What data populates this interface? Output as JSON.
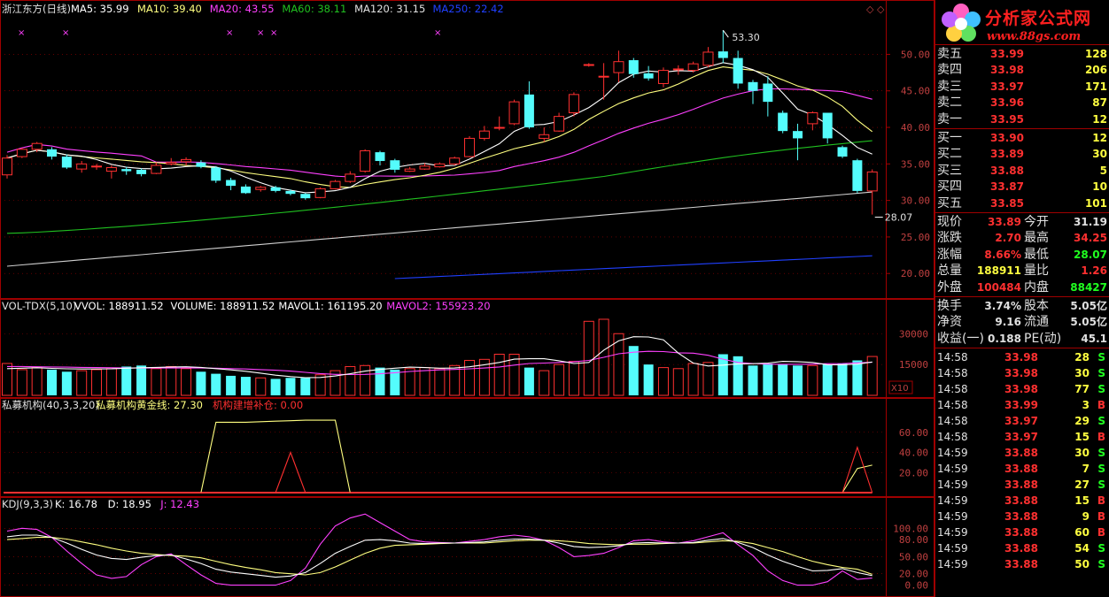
{
  "colors": {
    "up": "#ff3030",
    "down": "#54fcfc",
    "ma5": "#ffffff",
    "ma10": "#ffff80",
    "ma20": "#ff40ff",
    "ma60": "#20c020",
    "ma120": "#d0d0d0",
    "ma250": "#2040ff",
    "grid": "#a00000",
    "axis_text": "#c04040"
  },
  "main_panel": {
    "stock_name": "浙江东方(日线)",
    "ma_legend": [
      {
        "label": "MA5: 35.99",
        "color": "#ffffff"
      },
      {
        "label": "MA10: 39.40",
        "color": "#ffff80"
      },
      {
        "label": "MA20: 43.55",
        "color": "#ff40ff"
      },
      {
        "label": "MA60: 38.11",
        "color": "#20c020"
      },
      {
        "label": "MA120: 31.15",
        "color": "#e0e0e0"
      },
      {
        "label": "MA250: 22.42",
        "color": "#2040ff"
      }
    ],
    "y_ticks": [
      "50.00",
      "45.00",
      "40.00",
      "35.00",
      "30.00",
      "25.00",
      "20.00"
    ],
    "high_annotation": "53.30",
    "low_annotation": "28.07",
    "window_controls": "◇ ◇"
  },
  "vol_panel": {
    "title": "VOL-TDX(5,10)",
    "legend": [
      {
        "label": "VVOL: 188911.52",
        "color": "#ffffff"
      },
      {
        "label": "VOLUME: 188911.52",
        "color": "#ffffff"
      },
      {
        "label": "MAVOL1: 161195.20",
        "color": "#ffffff"
      },
      {
        "label": "MAVOL2: 155923.20",
        "color": "#ff40ff"
      }
    ],
    "y_ticks": [
      "30000",
      "15000"
    ],
    "unit": "X10"
  },
  "fund_panel": {
    "title": "私募机构(40,3,3,20)",
    "legend": [
      {
        "label": "私募机构黄金线: 27.30",
        "color": "#ffff80"
      },
      {
        "label": "机构建增补仓: 0.00",
        "color": "#ff3030"
      }
    ],
    "y_ticks": [
      "60.00",
      "40.00",
      "20.00"
    ]
  },
  "kdj_panel": {
    "title": "KDJ(9,3,3)",
    "legend": [
      {
        "label": "K: 16.78",
        "color": "#ffffff"
      },
      {
        "label": "D: 18.95",
        "color": "#ffffff"
      },
      {
        "label": "J: 12.43",
        "color": "#ff40ff"
      }
    ],
    "y_ticks": [
      "100.00",
      "80.00",
      "50.00",
      "20.00",
      "0.00"
    ]
  },
  "chart_data": {
    "type": "candlestick",
    "candles": [
      [
        33.5,
        35.8,
        33.0,
        36.2
      ],
      [
        36.0,
        37.0,
        35.8,
        37.2
      ],
      [
        37.0,
        37.8,
        36.6,
        38.0
      ],
      [
        37.0,
        36.0,
        35.6,
        37.3
      ],
      [
        36.0,
        34.5,
        34.3,
        36.3
      ],
      [
        34.3,
        35.0,
        33.8,
        35.4
      ],
      [
        34.7,
        34.7,
        34.2,
        35.0
      ],
      [
        34.0,
        34.5,
        33.0,
        34.8
      ],
      [
        34.3,
        34.0,
        33.5,
        34.6
      ],
      [
        34.2,
        33.6,
        33.3,
        34.4
      ],
      [
        33.7,
        34.8,
        33.6,
        35.2
      ],
      [
        35.0,
        35.2,
        34.8,
        35.8
      ],
      [
        35.3,
        35.6,
        34.8,
        35.9
      ],
      [
        35.2,
        34.6,
        34.4,
        35.5
      ],
      [
        34.5,
        32.7,
        32.4,
        34.7
      ],
      [
        32.8,
        32.0,
        31.4,
        33.1
      ],
      [
        31.9,
        31.0,
        30.9,
        32.2
      ],
      [
        31.5,
        31.8,
        31.2,
        32.0
      ],
      [
        31.8,
        31.3,
        31.1,
        32.0
      ],
      [
        31.3,
        30.9,
        30.7,
        31.5
      ],
      [
        30.9,
        30.3,
        30.1,
        31.0
      ],
      [
        30.4,
        31.6,
        30.3,
        31.8
      ],
      [
        31.6,
        32.6,
        31.5,
        32.8
      ],
      [
        32.6,
        33.6,
        32.4,
        34.0
      ],
      [
        34.0,
        36.8,
        33.8,
        37.0
      ],
      [
        36.6,
        35.4,
        34.8,
        36.8
      ],
      [
        35.5,
        34.2,
        33.8,
        35.7
      ],
      [
        34.0,
        34.3,
        33.9,
        34.6
      ],
      [
        34.3,
        34.7,
        34.2,
        35.1
      ],
      [
        34.6,
        35.0,
        34.5,
        35.2
      ],
      [
        35.0,
        35.8,
        34.8,
        36.0
      ],
      [
        36.0,
        38.5,
        35.9,
        38.8
      ],
      [
        38.5,
        39.5,
        38.2,
        40.2
      ],
      [
        40.0,
        40.0,
        39.6,
        41.5
      ],
      [
        40.5,
        43.5,
        40.3,
        43.8
      ],
      [
        44.5,
        40.0,
        39.8,
        46.3
      ],
      [
        38.5,
        39.0,
        38.0,
        40.0
      ],
      [
        39.5,
        41.5,
        39.4,
        42.0
      ],
      [
        42.0,
        44.5,
        41.5,
        44.8
      ],
      [
        48.5,
        48.6,
        48.3,
        48.8
      ],
      [
        47.0,
        47.0,
        43.8,
        48.8
      ],
      [
        47.5,
        49.0,
        46.2,
        50.5
      ],
      [
        49.2,
        47.3,
        46.8,
        49.5
      ],
      [
        47.4,
        46.7,
        46.4,
        48.4
      ],
      [
        46.0,
        47.8,
        45.5,
        48.2
      ],
      [
        47.9,
        48.0,
        47.2,
        48.5
      ],
      [
        47.8,
        48.7,
        47.5,
        49.0
      ],
      [
        48.5,
        50.3,
        48.2,
        51.0
      ],
      [
        50.4,
        49.5,
        48.8,
        53.3
      ],
      [
        49.5,
        46.0,
        45.3,
        50.5
      ],
      [
        46.2,
        45.0,
        43.2,
        46.5
      ],
      [
        46.0,
        43.5,
        41.5,
        47.0
      ],
      [
        42.0,
        39.5,
        39.2,
        42.3
      ],
      [
        39.5,
        38.5,
        35.5,
        40.5
      ],
      [
        40.5,
        42.0,
        39.6,
        42.2
      ],
      [
        42.0,
        38.5,
        37.8,
        42.0
      ],
      [
        37.3,
        36.0,
        35.8,
        37.5
      ],
      [
        35.5,
        31.3,
        31.0,
        35.7
      ],
      [
        31.3,
        33.9,
        28.07,
        34.25
      ]
    ],
    "volume": [
      15500,
      12500,
      13500,
      12500,
      11500,
      12000,
      12500,
      13000,
      14000,
      14500,
      13000,
      14000,
      13000,
      11500,
      10500,
      9500,
      9000,
      8500,
      8000,
      8500,
      8500,
      10000,
      12000,
      14000,
      14500,
      13500,
      12500,
      13000,
      13500,
      13000,
      14500,
      17000,
      17500,
      20000,
      20000,
      13500,
      12000,
      15000,
      16500,
      36000,
      37000,
      30000,
      24000,
      15000,
      13500,
      13000,
      15500,
      16000,
      20000,
      19000,
      14500,
      15500,
      15000,
      14500,
      14500,
      15000,
      15500,
      17000,
      18900
    ],
    "mavol1": [
      13000,
      13200,
      13400,
      13100,
      12900,
      12800,
      12800,
      12900,
      13200,
      13400,
      13600,
      13800,
      13900,
      13600,
      13000,
      12400,
      11700,
      10800,
      9800,
      9100,
      8600,
      8700,
      9400,
      10500,
      11800,
      12600,
      13200,
      13700,
      13500,
      13200,
      13300,
      13900,
      14900,
      16000,
      17600,
      17800,
      17800,
      16800,
      15500,
      16000,
      22000,
      26500,
      28500,
      28400,
      27000,
      20500,
      15700,
      14300,
      14700,
      15300,
      15400,
      15700,
      16500,
      16400,
      16000,
      14900,
      14900,
      15200,
      16200
    ],
    "mavol2": [
      14000,
      14000,
      13900,
      13800,
      13700,
      13600,
      13500,
      13400,
      13300,
      13300,
      13300,
      13300,
      13300,
      13300,
      13200,
      13000,
      12800,
      12500,
      12200,
      11800,
      11200,
      10600,
      10200,
      10100,
      10200,
      10500,
      11000,
      11600,
      12000,
      12400,
      12600,
      12900,
      13300,
      13800,
      14700,
      15500,
      15700,
      16000,
      16300,
      17000,
      18500,
      20200,
      21000,
      21400,
      21300,
      20700,
      20500,
      19500,
      17600,
      16000,
      15500,
      15200,
      15100,
      15100,
      15200,
      15400,
      15500,
      15800,
      16100
    ],
    "fund_gold": [
      0,
      0,
      0,
      0,
      0,
      0,
      0,
      0,
      0,
      0,
      0,
      0,
      0,
      0,
      70,
      70,
      70,
      70.5,
      71,
      71.5,
      72,
      72,
      72,
      0,
      0,
      0,
      0,
      0,
      0,
      0,
      0,
      0,
      0,
      0,
      0,
      0,
      0,
      0,
      0,
      0,
      0,
      0,
      0,
      0,
      0,
      0,
      0,
      0,
      0,
      0,
      0,
      0,
      0,
      0,
      0,
      0,
      0,
      24,
      27.3
    ],
    "fund_add": [
      0,
      0,
      0,
      0,
      0,
      0,
      0,
      0,
      0,
      0,
      0,
      0,
      0,
      0,
      0,
      0,
      0,
      0,
      0,
      40,
      0,
      0,
      0,
      0,
      0,
      0,
      0,
      0,
      0,
      0,
      0,
      0,
      0,
      0,
      0,
      0,
      0,
      0,
      0,
      0,
      0,
      0,
      0,
      0,
      0,
      0,
      0,
      0,
      0,
      0,
      0,
      0,
      0,
      0,
      0,
      0,
      0,
      45,
      0
    ],
    "kdj_k": [
      85,
      88,
      88,
      84,
      74,
      63,
      53,
      47,
      45,
      49,
      52,
      53,
      46,
      38,
      28,
      23,
      20,
      17,
      14,
      16,
      22,
      38,
      56,
      68,
      79,
      80,
      78,
      74,
      73,
      74,
      74,
      75,
      76,
      79,
      81,
      81,
      79,
      74,
      68,
      66,
      67,
      69,
      74,
      75,
      74,
      74,
      75,
      79,
      82,
      75,
      66,
      53,
      42,
      33,
      25,
      26,
      29,
      22,
      16.78
    ],
    "kdj_d": [
      80,
      82,
      84,
      84,
      81,
      76,
      71,
      65,
      60,
      56,
      54,
      52,
      51,
      48,
      42,
      36,
      31,
      27,
      22,
      20,
      18,
      22,
      32,
      44,
      56,
      65,
      70,
      71,
      72,
      73,
      74,
      74,
      74,
      76,
      78,
      79,
      79,
      78,
      76,
      73,
      72,
      71,
      72,
      72,
      73,
      74,
      74,
      76,
      78,
      77,
      73,
      66,
      59,
      50,
      42,
      36,
      31,
      28,
      18.95
    ],
    "kdj_j": [
      95,
      100,
      98,
      84,
      60,
      38,
      18,
      12,
      15,
      36,
      50,
      55,
      36,
      18,
      3,
      0,
      0,
      0,
      0,
      8,
      30,
      72,
      104,
      118,
      125,
      110,
      95,
      80,
      76,
      75,
      74,
      77,
      80,
      85,
      88,
      85,
      79,
      66,
      50,
      52,
      56,
      66,
      78,
      80,
      76,
      74,
      78,
      85,
      92,
      71,
      52,
      25,
      8,
      0,
      0,
      6,
      25,
      10,
      12.43
    ]
  },
  "sidebar": {
    "logo_text": "分析家公式网",
    "logo_url": "www.88gs.com",
    "asks": [
      {
        "label": "卖五",
        "price": "33.99",
        "vol": "128"
      },
      {
        "label": "卖四",
        "price": "33.98",
        "vol": "206"
      },
      {
        "label": "卖三",
        "price": "33.97",
        "vol": "171"
      },
      {
        "label": "卖二",
        "price": "33.96",
        "vol": "87"
      },
      {
        "label": "卖一",
        "price": "33.95",
        "vol": "12"
      }
    ],
    "bids": [
      {
        "label": "买一",
        "price": "33.90",
        "vol": "12"
      },
      {
        "label": "买二",
        "price": "33.89",
        "vol": "30"
      },
      {
        "label": "买三",
        "price": "33.88",
        "vol": "5"
      },
      {
        "label": "买四",
        "price": "33.87",
        "vol": "10"
      },
      {
        "label": "买五",
        "price": "33.85",
        "vol": "101"
      }
    ],
    "quote": [
      {
        "l1": "现价",
        "v1": "33.89",
        "c1": "red",
        "l2": "今开",
        "v2": "31.19",
        "c2": "wht"
      },
      {
        "l1": "涨跌",
        "v1": "2.70",
        "c1": "red",
        "l2": "最高",
        "v2": "34.25",
        "c2": "red"
      },
      {
        "l1": "涨幅",
        "v1": "8.66%",
        "c1": "red",
        "l2": "最低",
        "v2": "28.07",
        "c2": "grn"
      },
      {
        "l1": "总量",
        "v1": "188911",
        "c1": "yel",
        "l2": "量比",
        "v2": "1.26",
        "c2": "red"
      },
      {
        "l1": "外盘",
        "v1": "100484",
        "c1": "red",
        "l2": "内盘",
        "v2": "88427",
        "c2": "grn"
      }
    ],
    "stats": [
      {
        "l1": "换手",
        "v1": "3.74%",
        "l2": "股本",
        "v2": "5.05亿"
      },
      {
        "l1": "净资",
        "v1": "9.16",
        "l2": "流通",
        "v2": "5.05亿"
      },
      {
        "l1": "收益(一)",
        "v1": "0.188",
        "l2": "PE(动)",
        "v2": "45.1"
      }
    ],
    "ticks": [
      {
        "time": "14:58",
        "price": "33.98",
        "vol": "28",
        "side": "S"
      },
      {
        "time": "14:58",
        "price": "33.98",
        "vol": "30",
        "side": "S"
      },
      {
        "time": "14:58",
        "price": "33.98",
        "vol": "77",
        "side": "S"
      },
      {
        "time": "14:58",
        "price": "33.99",
        "vol": "3",
        "side": "B"
      },
      {
        "time": "14:58",
        "price": "33.97",
        "vol": "29",
        "side": "S"
      },
      {
        "time": "14:58",
        "price": "33.97",
        "vol": "15",
        "side": "B"
      },
      {
        "time": "14:59",
        "price": "33.88",
        "vol": "30",
        "side": "S"
      },
      {
        "time": "14:59",
        "price": "33.88",
        "vol": "7",
        "side": "S"
      },
      {
        "time": "14:59",
        "price": "33.88",
        "vol": "27",
        "side": "S"
      },
      {
        "time": "14:59",
        "price": "33.88",
        "vol": "15",
        "side": "B"
      },
      {
        "time": "14:59",
        "price": "33.88",
        "vol": "9",
        "side": "B"
      },
      {
        "time": "14:59",
        "price": "33.88",
        "vol": "60",
        "side": "B"
      },
      {
        "time": "14:59",
        "price": "33.88",
        "vol": "54",
        "side": "S"
      },
      {
        "time": "14:59",
        "price": "33.88",
        "vol": "50",
        "side": "S"
      }
    ]
  }
}
